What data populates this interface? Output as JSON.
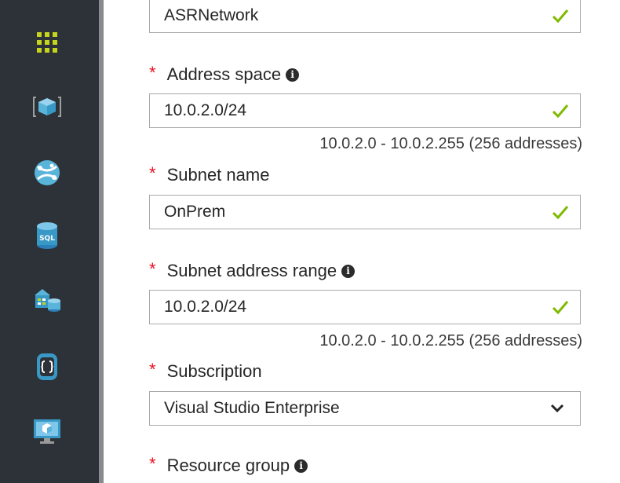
{
  "sidebar": {
    "icons": [
      {
        "name": "all-resources-grid-icon",
        "color": "#c7d41d"
      },
      {
        "name": "virtual-machine-classic-icon",
        "color": "#59b4d9"
      },
      {
        "name": "app-services-globe-icon",
        "color": "#59b4d9"
      },
      {
        "name": "sql-database-icon",
        "label": "SQL",
        "color": "#3999c6"
      },
      {
        "name": "storage-servers-icon",
        "color": "#3999c6"
      },
      {
        "name": "cloud-service-icon",
        "color": "#3999c6"
      },
      {
        "name": "virtual-machine-monitor-icon",
        "color": "#3999c6"
      }
    ]
  },
  "form": {
    "name": {
      "value": "ASRNetwork"
    },
    "address_space": {
      "required": "*",
      "label": "Address space",
      "info": "i",
      "value": "10.0.2.0/24",
      "range": "10.0.2.0 - 10.0.2.255 (256 addresses)"
    },
    "subnet_name": {
      "required": "*",
      "label": "Subnet name",
      "value": "OnPrem"
    },
    "subnet_address_range": {
      "required": "*",
      "label": "Subnet address range",
      "info": "i",
      "value": "10.0.2.0/24",
      "range": "10.0.2.0 - 10.0.2.255 (256 addresses)"
    },
    "subscription": {
      "required": "*",
      "label": "Subscription",
      "value": "Visual Studio Enterprise"
    },
    "resource_group": {
      "required": "*",
      "label": "Resource group",
      "info": "i"
    }
  },
  "colors": {
    "rail_bg": "#2c3237",
    "required_star": "#e81123",
    "valid_check": "#7fba00",
    "field_border": "#a9a9a9"
  }
}
